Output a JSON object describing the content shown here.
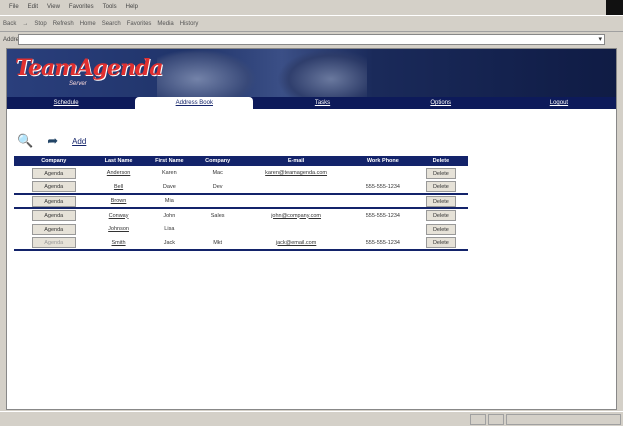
{
  "menu": [
    "File",
    "Edit",
    "View",
    "Favorites",
    "Tools",
    "Help"
  ],
  "toolbar": [
    "Back",
    "→",
    "Stop",
    "Refresh",
    "Home",
    "Search",
    "Favorites",
    "Media",
    "History"
  ],
  "address": {
    "label": "Address",
    "value": ""
  },
  "banner": {
    "logo": "TeamAgenda",
    "logo_sub": "Server"
  },
  "nav": [
    "Schedule",
    "Address Book",
    "Tasks",
    "Options",
    "Logout"
  ],
  "icons": {
    "add_label": "Add"
  },
  "columns": [
    "Company",
    "Last Name",
    "First Name",
    "Company",
    "E-mail",
    "Work Phone",
    "Delete"
  ],
  "rows": [
    {
      "btn": "Agenda",
      "dim": false,
      "last": "Anderson",
      "first": "Karen",
      "company": "Mac",
      "email": "karen@teamagenda.com",
      "phone": "",
      "del": "Delete",
      "sep": false
    },
    {
      "btn": "Agenda",
      "dim": false,
      "last": "Bell",
      "first": "Dave",
      "company": "Dev",
      "email": "",
      "phone": "555-555-1234",
      "del": "Delete",
      "sep": false
    },
    {
      "btn": "Agenda",
      "dim": false,
      "last": "Brown",
      "first": "Mia",
      "company": "",
      "email": "",
      "phone": "",
      "del": "Delete",
      "sep": true
    },
    {
      "btn": "Agenda",
      "dim": false,
      "last": "Conway",
      "first": "John",
      "company": "Sales",
      "email": "john@company.com",
      "phone": "555-555-1234",
      "del": "Delete",
      "sep": true
    },
    {
      "btn": "Agenda",
      "dim": false,
      "last": "Johnson",
      "first": "Lisa",
      "company": "",
      "email": "",
      "phone": "",
      "del": "Delete",
      "sep": false
    },
    {
      "btn": "Agenda",
      "dim": true,
      "last": "Smith",
      "first": "Jack",
      "company": "Mkt",
      "email": "jack@email.com",
      "phone": "555-555-1234",
      "del": "Delete",
      "sep": false
    }
  ]
}
